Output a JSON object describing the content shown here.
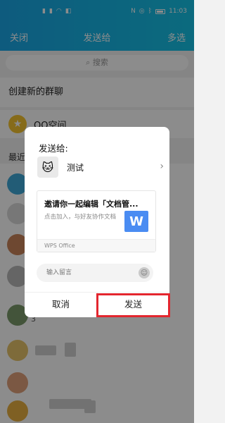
{
  "status_bar": {
    "left_icons": [
      "4G",
      "4G",
      "wifi",
      "app"
    ],
    "right_icons": [
      "nfc",
      "mute",
      "bluetooth"
    ],
    "time": "11:03"
  },
  "nav": {
    "close": "关闭",
    "title": "发送给",
    "multi": "多选"
  },
  "search": {
    "placeholder": "搜索"
  },
  "rows": {
    "create_group": "创建新的群聊",
    "qzone": "QQ空间",
    "recent": "最近"
  },
  "list": {
    "visible_number": "3"
  },
  "dialog": {
    "title": "发送给:",
    "recipient_name": "测试",
    "card_title": "邀请你一起编辑「文档管...",
    "card_desc": "点击加入，与好友协作文档",
    "card_source": "WPS Office",
    "message_placeholder": "输入留言",
    "cancel_label": "取消",
    "send_label": "发送"
  },
  "colors": {
    "accent": "#1aa6e6",
    "highlight": "#e3262e",
    "wps": "#4a8cf2"
  }
}
